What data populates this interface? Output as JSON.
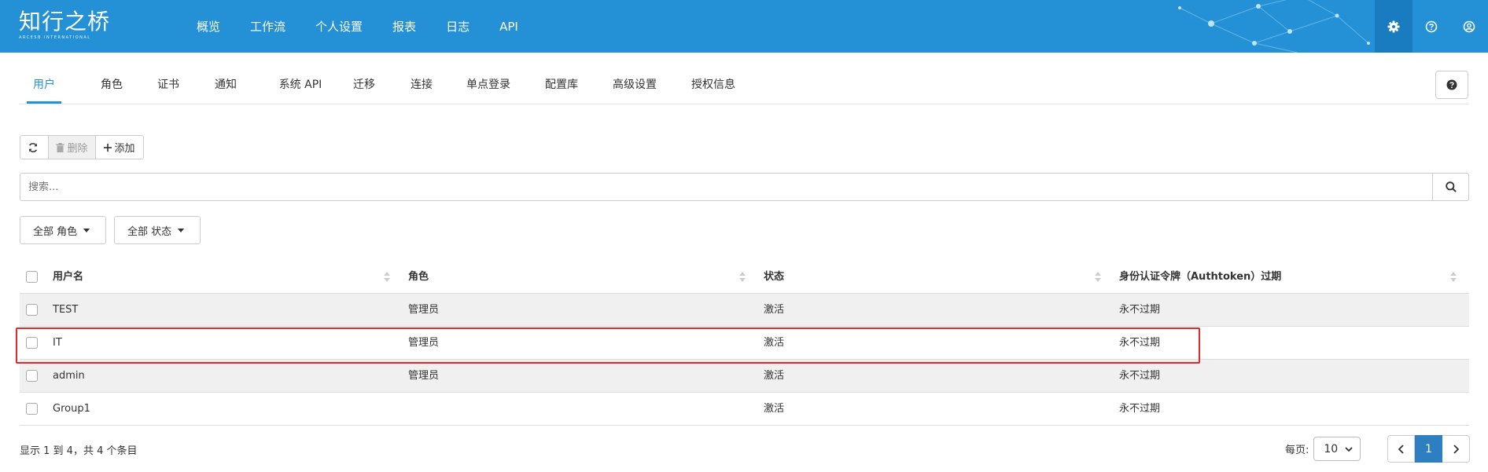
{
  "header": {
    "logo_text": "知行之桥",
    "logo_subtext": "ARCESB INTERNATIONAL",
    "nav": [
      "概览",
      "工作流",
      "个人设置",
      "报表",
      "日志",
      "API"
    ],
    "icons": [
      "gear-icon",
      "question-circle-icon",
      "user-circle-icon"
    ],
    "brand_color": "#2491d6"
  },
  "tabs": {
    "items": [
      "用户",
      "角色",
      "证书",
      "通知",
      "系统 API",
      "迁移",
      "连接",
      "单点登录",
      "配置库",
      "高级设置",
      "授权信息"
    ],
    "active": "用户"
  },
  "toolbar": {
    "delete_label": "删除",
    "add_label": "添加"
  },
  "search": {
    "placeholder": "搜索..."
  },
  "filters": {
    "role": "全部 角色",
    "status": "全部 状态"
  },
  "table": {
    "headers": [
      "用户名",
      "角色",
      "状态",
      "身份认证令牌（Authtoken）过期"
    ],
    "rows": [
      [
        "TEST",
        "管理员",
        "激活",
        "永不过期"
      ],
      [
        "IT",
        "管理员",
        "激活",
        "永不过期"
      ],
      [
        "admin",
        "管理员",
        "激活",
        "永不过期"
      ],
      [
        "Group1",
        "",
        "激活",
        "永不过期"
      ]
    ],
    "highlight_color": "#e8262b"
  },
  "footer": {
    "summary": "显示 1 到 4，共 4 个条目",
    "per_page_label": "每页:",
    "per_page_value": "10",
    "current_page": "1"
  }
}
